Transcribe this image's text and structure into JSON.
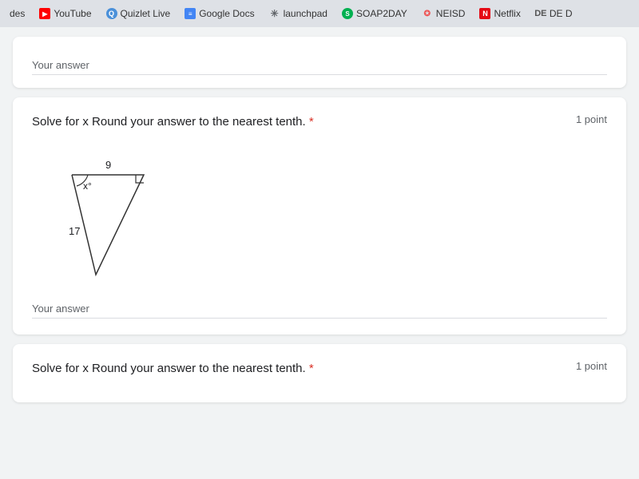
{
  "tabBar": {
    "tabs": [
      {
        "id": "des",
        "label": "des",
        "iconClass": "",
        "iconText": ""
      },
      {
        "id": "youtube",
        "label": "YouTube",
        "iconClass": "icon-yt",
        "iconText": "▶"
      },
      {
        "id": "quizlet",
        "label": "Quizlet Live",
        "iconClass": "icon-q",
        "iconText": "Q"
      },
      {
        "id": "googledocs",
        "label": "Google Docs",
        "iconClass": "icon-docs",
        "iconText": "≡"
      },
      {
        "id": "launchpad",
        "label": "launchpad",
        "iconClass": "icon-launch",
        "iconText": "✳"
      },
      {
        "id": "soap2day",
        "label": "SOAP2DAY",
        "iconClass": "icon-soap",
        "iconText": "S"
      },
      {
        "id": "neisd",
        "label": "NEISD",
        "iconClass": "icon-neisd",
        "iconText": "✪"
      },
      {
        "id": "netflix",
        "label": "Netflix",
        "iconClass": "icon-netflix",
        "iconText": "N"
      },
      {
        "id": "de",
        "label": "DE D",
        "iconClass": "icon-de",
        "iconText": "DE"
      }
    ]
  },
  "firstCard": {
    "answerLabel": "Your answer"
  },
  "secondCard": {
    "questionText": "Solve for x Round your answer to the nearest tenth.",
    "required": true,
    "requiredMark": "*",
    "pointsLabel": "1 point",
    "diagram": {
      "sideTop": "9",
      "sideLeft": "17",
      "angleLabel": "x°"
    },
    "answerLabel": "Your answer"
  },
  "thirdCard": {
    "questionText": "Solve for x Round your answer to the nearest tenth.",
    "required": true,
    "requiredMark": "*",
    "pointsLabel": "1 point"
  }
}
